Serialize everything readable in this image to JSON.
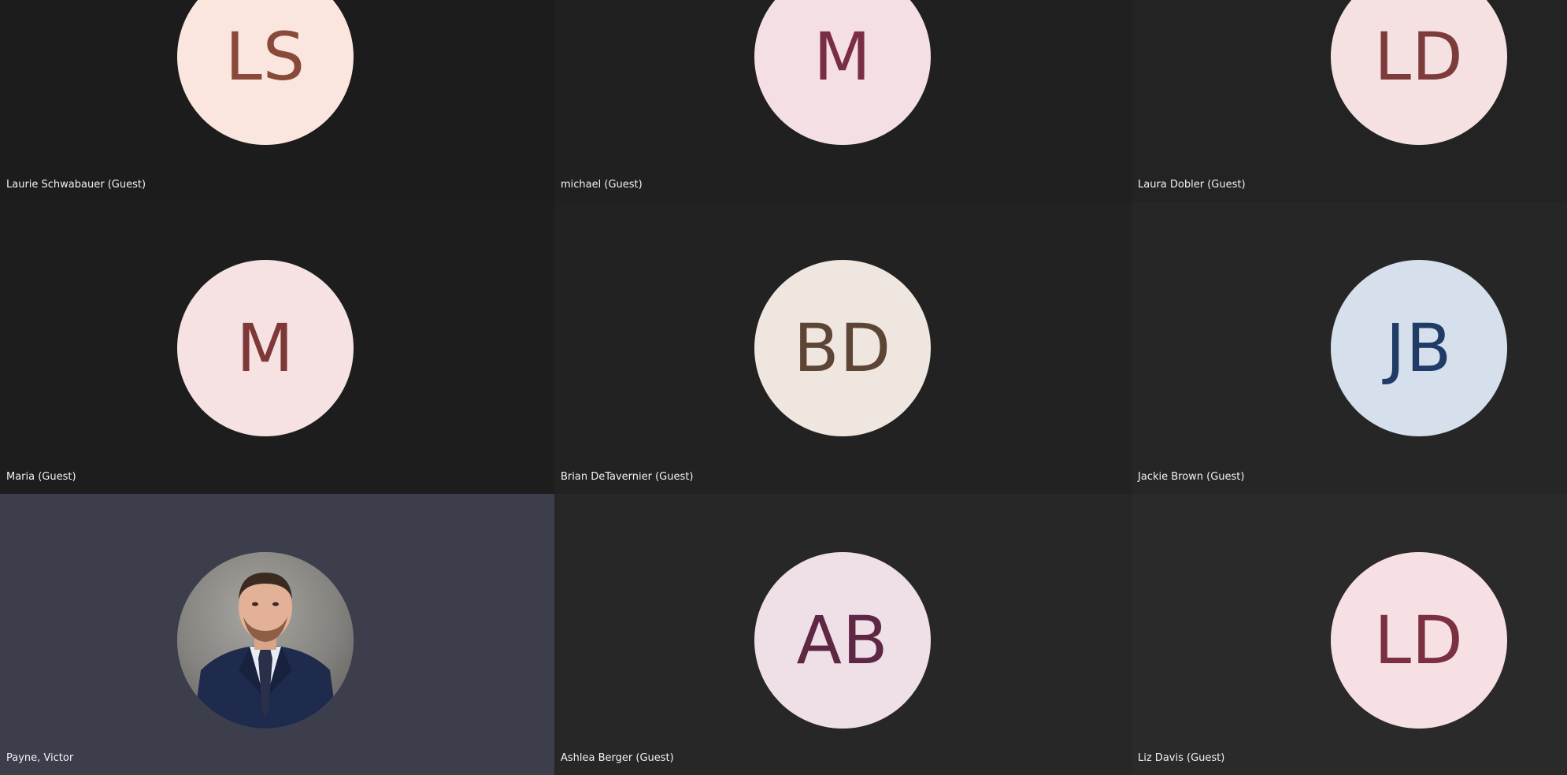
{
  "participants": [
    {
      "initials": "LS",
      "name": "Laurie Schwabauer (Guest)",
      "avatar_bg": "#fbe6df",
      "initials_color": "#8a4a3b",
      "tile_bg": "#1c1c1c"
    },
    {
      "initials": "M",
      "name": "michael (Guest)",
      "avatar_bg": "#f4dfe4",
      "initials_color": "#7a2e45",
      "tile_bg": "#202020"
    },
    {
      "initials": "LD",
      "name": "Laura Dobler (Guest)",
      "avatar_bg": "#f5e1e1",
      "initials_color": "#7d3b3b",
      "tile_bg": "#232323"
    },
    {
      "initials": "M",
      "name": "Maria (Guest)",
      "avatar_bg": "#f6e2e2",
      "initials_color": "#7d3838",
      "tile_bg": "#1d1d1d"
    },
    {
      "initials": "BD",
      "name": "Brian DeTavernier (Guest)",
      "avatar_bg": "#efe6e0",
      "initials_color": "#5d4536",
      "tile_bg": "#222222"
    },
    {
      "initials": "JB",
      "name": "Jackie Brown (Guest)",
      "avatar_bg": "#d6e0ec",
      "initials_color": "#1f3b66",
      "tile_bg": "#262626"
    },
    {
      "initials": "",
      "name": "Payne, Victor",
      "avatar_bg": "#8a8884",
      "initials_color": "#ffffff",
      "tile_bg": "#3d3e4c"
    },
    {
      "initials": "AB",
      "name": "Ashlea Berger (Guest)",
      "avatar_bg": "#efdfe7",
      "initials_color": "#5e2845",
      "tile_bg": "#272727"
    },
    {
      "initials": "LD",
      "name": "Liz Davis (Guest)",
      "avatar_bg": "#f6e0e4",
      "initials_color": "#7a3040",
      "tile_bg": "#2a2a2a"
    }
  ]
}
